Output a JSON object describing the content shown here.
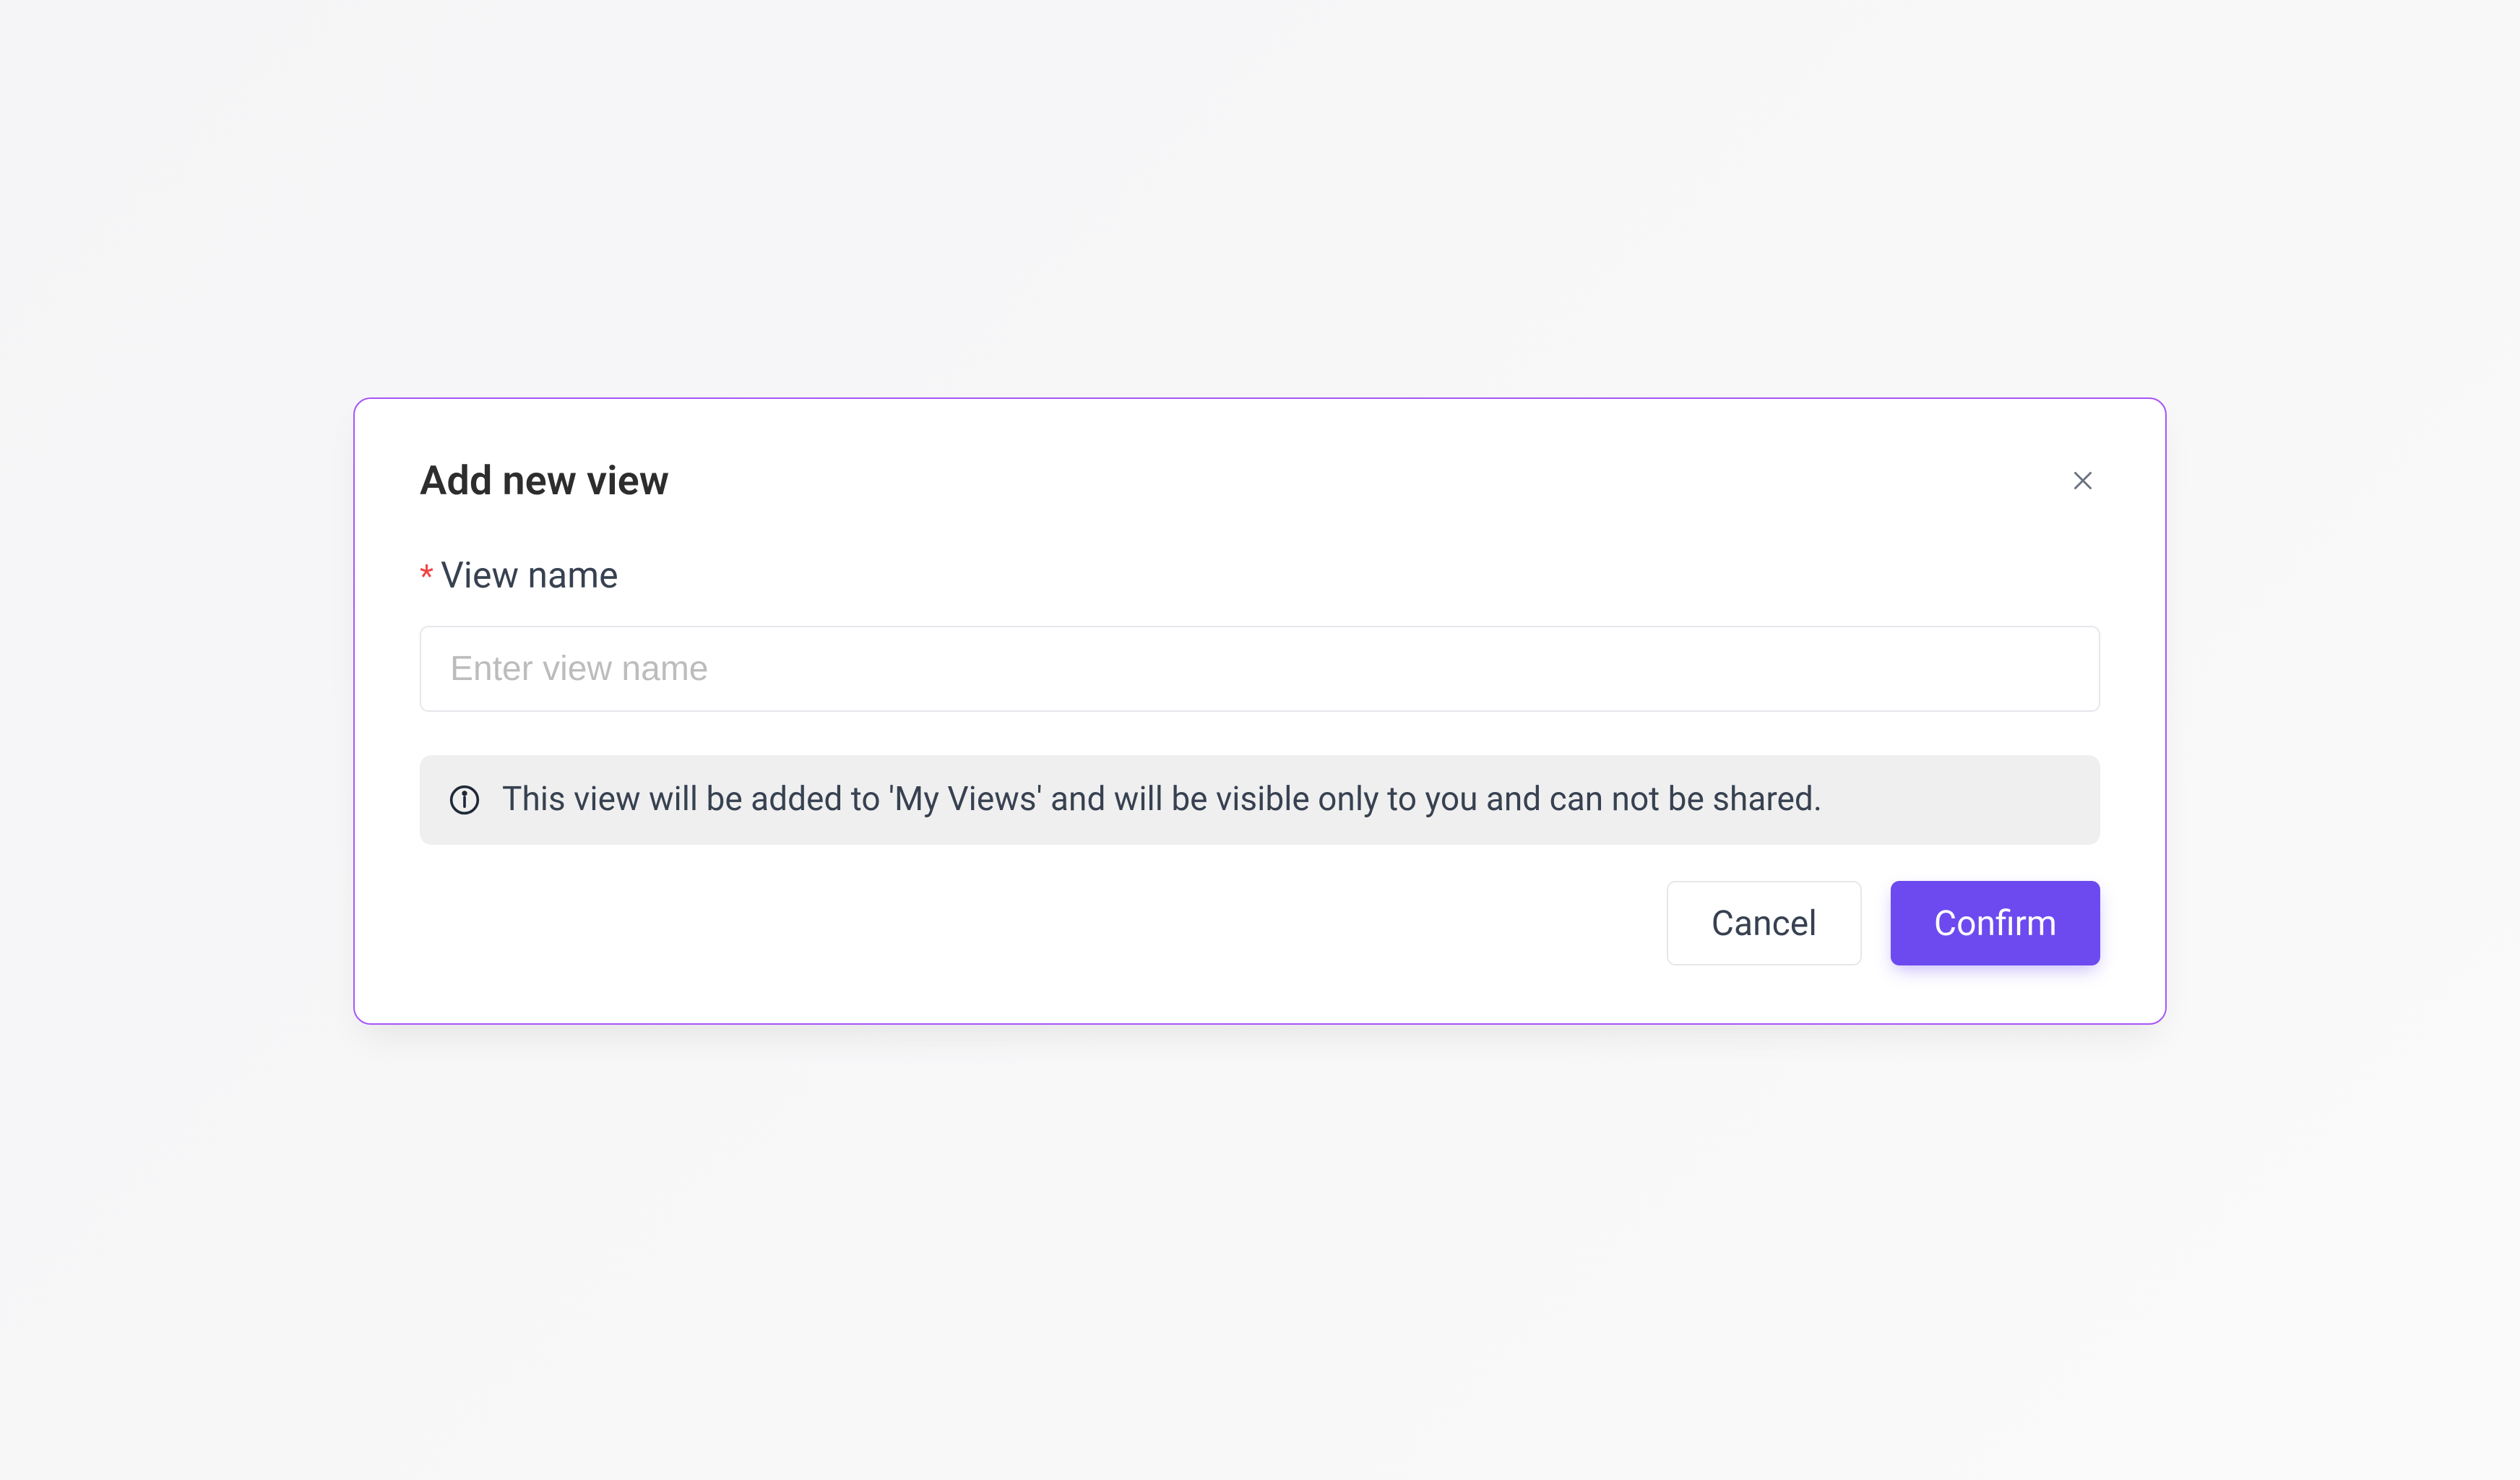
{
  "modal": {
    "title": "Add new view",
    "field": {
      "label": "View name",
      "placeholder": "Enter view name",
      "value": ""
    },
    "info_text": "This view will be added to 'My Views' and will be visible only to you and can not be shared.",
    "buttons": {
      "cancel": "Cancel",
      "confirm": "Confirm"
    }
  }
}
